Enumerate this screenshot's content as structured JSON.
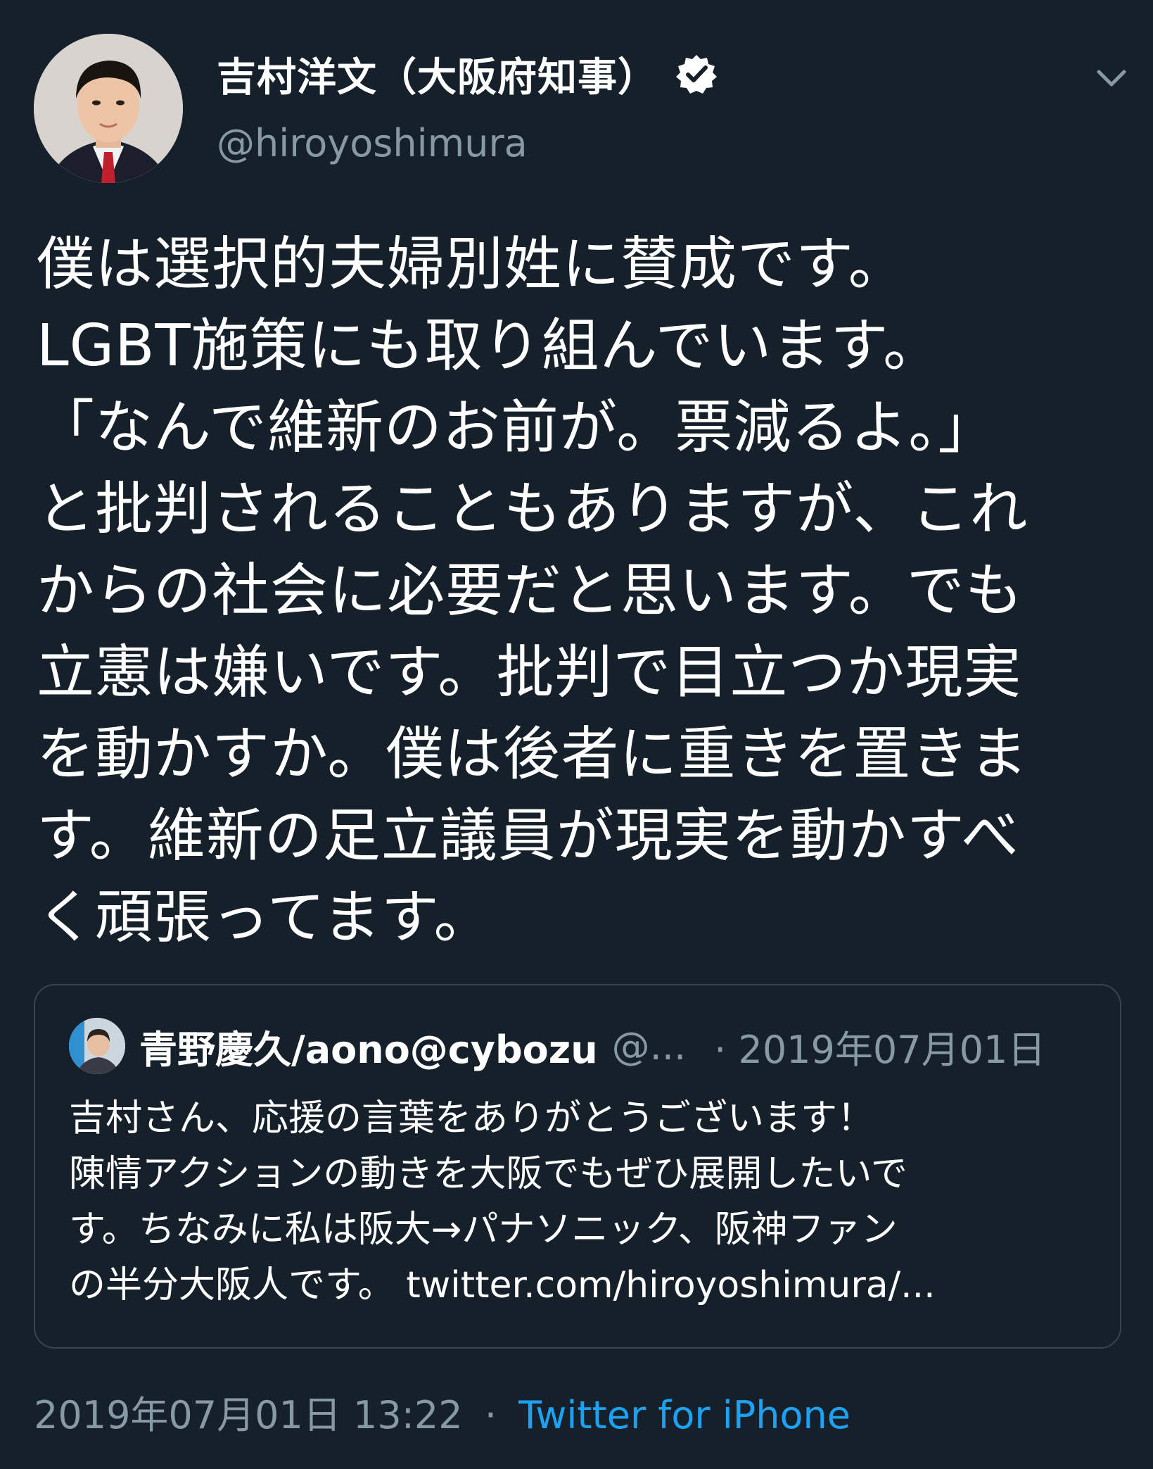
{
  "author": {
    "display_name": "吉村洋文（大阪府知事）",
    "handle": "@hiroyoshimura",
    "verified_icon": "verified-badge-icon",
    "more_icon": "chevron-down-icon"
  },
  "tweet": {
    "text": "僕は選択的夫婦別姓に賛成です。\nLGBT施策にも取り組んでいます。\n「なんで維新のお前が。票減るよ。」\nと批判されることもありますが、これ\nからの社会に必要だと思います。でも\n立憲は嫌いです。批判で目立つか現実\nを動かすか。僕は後者に重きを置きま\nす。維新の足立議員が現実を動かすべ\nく頑張ってます。"
  },
  "quoted_tweet": {
    "display_name": "青野慶久/aono@cybozu",
    "handle": "@...",
    "date": "· 2019年07月01日",
    "text": "吉村さん、応援の言葉をありがとうございます！\n陳情アクションの動きを大阪でもぜひ展開したいで\nす。ちなみに私は阪大→パナソニック、阪神ファン\nの半分大阪人です。 twitter.com/hiroyoshimura/..."
  },
  "footer": {
    "timestamp": "2019年07月01日 13:22",
    "separator": "·",
    "source": "Twitter for iPhone"
  },
  "colors": {
    "background": "#15202b",
    "secondary_text": "#8899a6",
    "link": "#1da1f2",
    "border": "#38444d"
  }
}
